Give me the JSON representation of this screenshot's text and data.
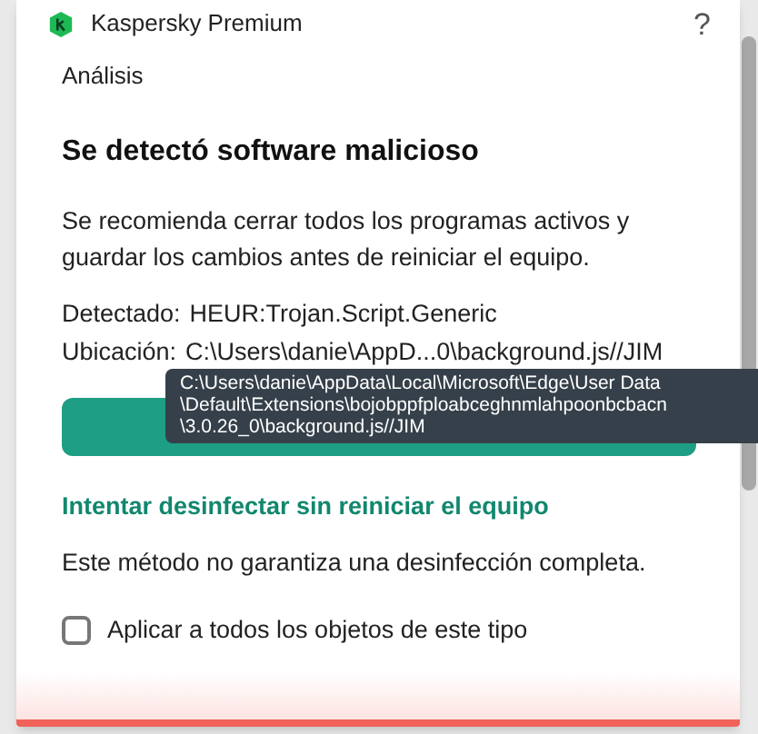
{
  "window": {
    "title": "Kaspersky Premium",
    "help": "?"
  },
  "section": "Análisis",
  "heading": "Se detectó software malicioso",
  "message": "Se recomienda cerrar todos los programas activos y guardar los cambios antes de reiniciar el equipo.",
  "details": [
    {
      "label": "Detectado:",
      "value": "HEUR:Trojan.Script.Generic"
    },
    {
      "label": "Ubicación:",
      "value": "C:\\Users\\danie\\AppD...0\\background.js//JIM"
    }
  ],
  "tooltip": [
    "C:\\Users\\danie\\AppData\\Local\\Microsoft\\Edge\\User Data",
    "\\Default\\Extensions\\bojobppfploabceghnmlahpoonbcbacn",
    "\\3.0.26_0\\background.js//JIM"
  ],
  "link": "Intentar desinfectar sin reiniciar el equipo",
  "note": "Este método no garantiza una desinfección completa.",
  "checkbox": {
    "label": "Aplicar a todos los objetos de este tipo",
    "checked": false
  }
}
